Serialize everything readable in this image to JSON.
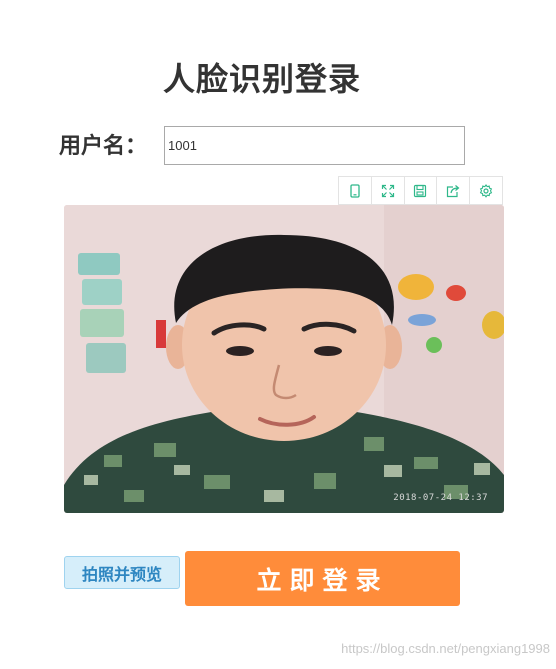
{
  "page": {
    "title": "人脸识别登录"
  },
  "form": {
    "username_label": "用户名：",
    "username_value": "1001"
  },
  "toolbar": {
    "items": [
      {
        "icon": "phone-icon"
      },
      {
        "icon": "fullscreen-icon"
      },
      {
        "icon": "save-icon"
      },
      {
        "icon": "share-icon"
      },
      {
        "icon": "settings-icon"
      }
    ],
    "icon_color": "#2fb88a"
  },
  "photo": {
    "timestamp": "2018-07-24 12:37"
  },
  "actions": {
    "preview_label": "拍照并预览",
    "login_label": "立即登录"
  },
  "watermark": "https://blog.csdn.net/pengxiang1998",
  "colors": {
    "login_button": "#ff8c3a",
    "preview_button_bg": "#d6eefa",
    "preview_button_text": "#2e86c1"
  }
}
